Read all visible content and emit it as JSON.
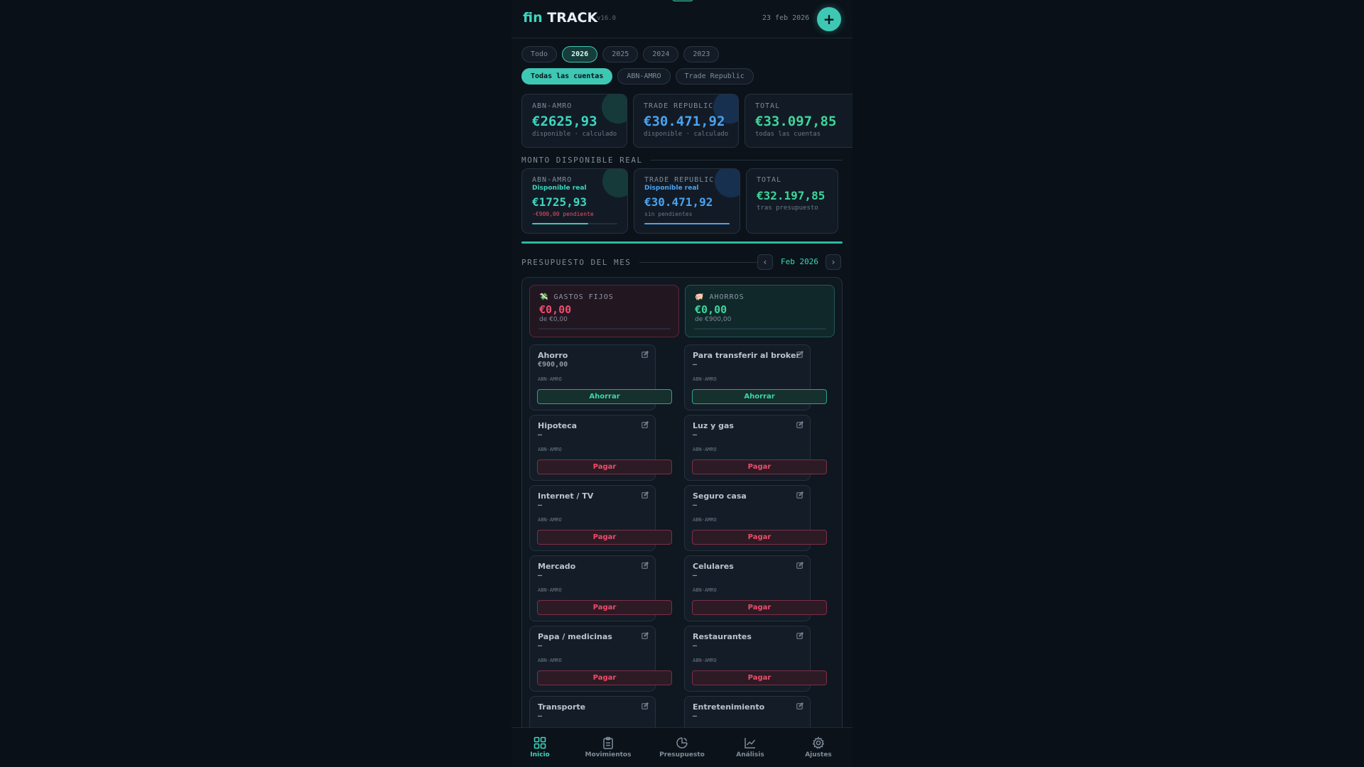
{
  "header": {
    "logo_prefix": "fin",
    "logo_main": "TRACK",
    "version": "v16.0",
    "date": "23 feb 2026",
    "add_label": "+"
  },
  "years": [
    "Todo",
    "2026",
    "2025",
    "2024",
    "2023"
  ],
  "selected_year": "2026",
  "accounts": [
    "Todas las cuentas",
    "ABN-AMRO",
    "Trade Republic"
  ],
  "balances": [
    {
      "label": "ABN-AMRO",
      "value": "€2625,93",
      "sub": "disponible · calculado"
    },
    {
      "label": "TRADE REPUBLIC",
      "value": "€30.471,92",
      "sub": "disponible · calculado"
    },
    {
      "label": "TOTAL",
      "value": "€33.097,85",
      "sub": "todas las cuentas"
    }
  ],
  "available_section": "MONTO DISPONIBLE REAL",
  "available": [
    {
      "label": "ABN-AMRO",
      "tag": "Disponible real",
      "value": "€1725,93",
      "sub": "-€900,00 pendiente",
      "fill": 0.66
    },
    {
      "label": "TRADE REPUBLIC",
      "tag": "Disponible real",
      "value": "€30.471,92",
      "sub": "sin pendientes",
      "fill": 1.0
    },
    {
      "label": "TOTAL",
      "value": "€32.197,85",
      "sub": "tras presupuesto"
    }
  ],
  "budget": {
    "section": "PRESUPUESTO DEL MES",
    "month": "Feb 2026",
    "prev": "‹",
    "next": "›",
    "fixed": {
      "icon": "💸",
      "label": "GASTOS FIJOS",
      "value": "€0,00",
      "sub": "de €0,00",
      "fill": 0
    },
    "savings": {
      "icon": "🐖",
      "label": "AHORROS",
      "value": "€0,00",
      "sub": "de €900,00",
      "fill": 0
    },
    "items": [
      {
        "name": "Ahorro",
        "amount": "€900,00",
        "account": "ABN-AMRO",
        "action": "Ahorrar",
        "kind": "save"
      },
      {
        "name": "Para transferir al broker",
        "amount": "—",
        "account": "ABN-AMRO",
        "action": "Ahorrar",
        "kind": "save"
      },
      {
        "name": "Hipoteca",
        "amount": "—",
        "account": "ABN-AMRO",
        "action": "Pagar",
        "kind": "pay"
      },
      {
        "name": "Luz y gas",
        "amount": "—",
        "account": "ABN-AMRO",
        "action": "Pagar",
        "kind": "pay"
      },
      {
        "name": "Internet / TV",
        "amount": "—",
        "account": "ABN-AMRO",
        "action": "Pagar",
        "kind": "pay"
      },
      {
        "name": "Seguro casa",
        "amount": "—",
        "account": "ABN-AMRO",
        "action": "Pagar",
        "kind": "pay"
      },
      {
        "name": "Mercado",
        "amount": "—",
        "account": "ABN-AMRO",
        "action": "Pagar",
        "kind": "pay"
      },
      {
        "name": "Celulares",
        "amount": "—",
        "account": "ABN-AMRO",
        "action": "Pagar",
        "kind": "pay"
      },
      {
        "name": "Papa / medicinas",
        "amount": "—",
        "account": "ABN-AMRO",
        "action": "Pagar",
        "kind": "pay"
      },
      {
        "name": "Restaurantes",
        "amount": "—",
        "account": "ABN-AMRO",
        "action": "Pagar",
        "kind": "pay"
      },
      {
        "name": "Transporte",
        "amount": "—",
        "account": "",
        "action": "",
        "kind": "pay"
      },
      {
        "name": "Entretenimiento",
        "amount": "—",
        "account": "",
        "action": "",
        "kind": "pay"
      }
    ]
  },
  "nav": [
    {
      "label": "Inicio",
      "icon": "grid-icon"
    },
    {
      "label": "Movimientos",
      "icon": "clipboard-icon"
    },
    {
      "label": "Presupuesto",
      "icon": "budget-icon"
    },
    {
      "label": "Análisis",
      "icon": "chart-icon"
    },
    {
      "label": "Ajustes",
      "icon": "gear-icon"
    }
  ],
  "active_nav": "Inicio",
  "colors": {
    "accent": "#3ec8b4",
    "blue": "#4aa3f0",
    "red": "#ef4d6b",
    "green": "#3ed69a"
  }
}
